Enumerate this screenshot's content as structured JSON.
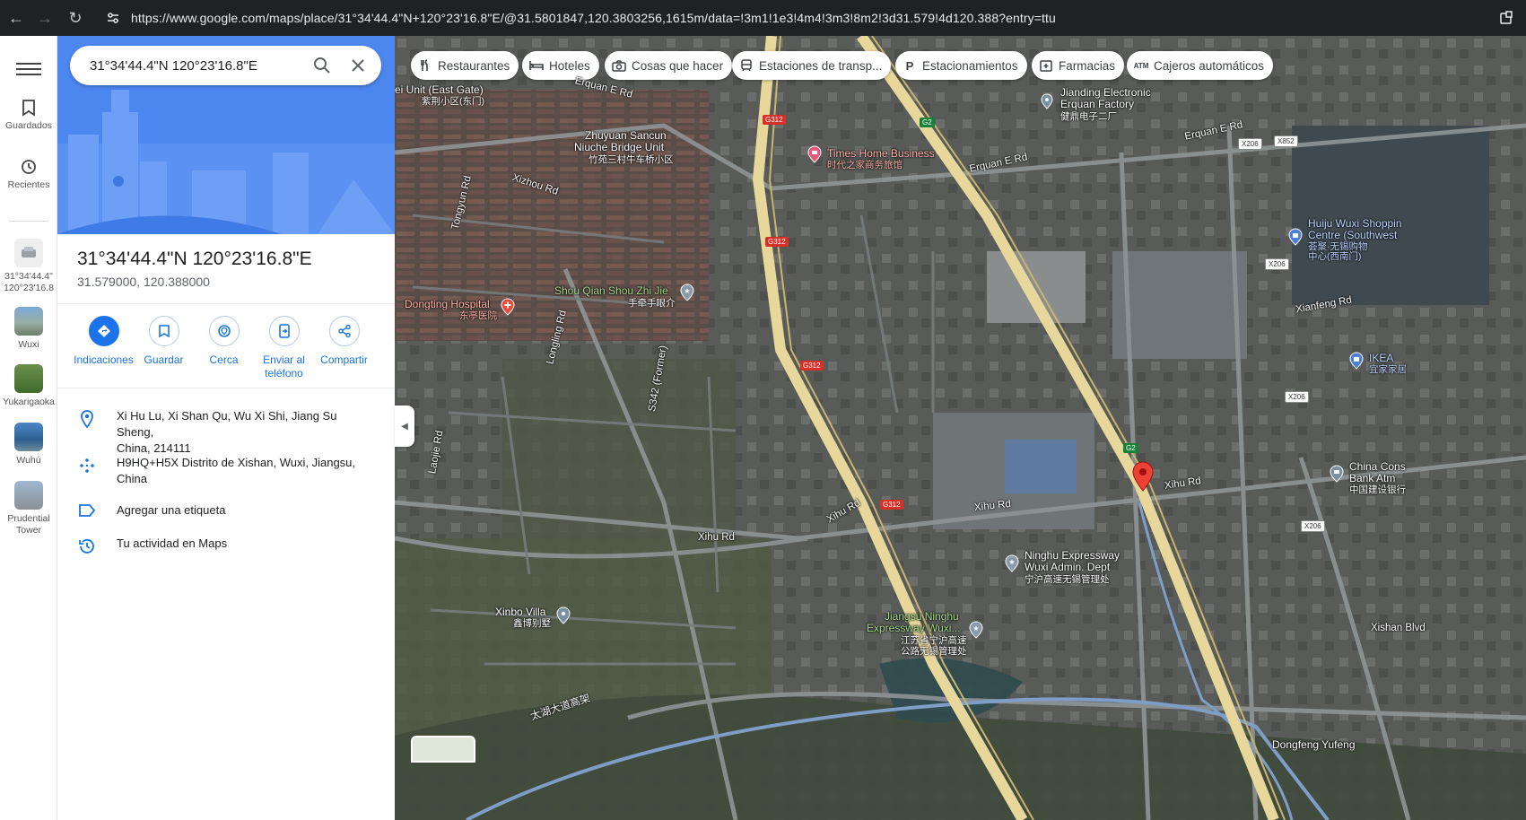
{
  "browser": {
    "url": "https://www.google.com/maps/place/31°34'44.4\"N+120°23'16.8\"E/@31.5801847,120.3803256,1615m/data=!3m1!1e3!4m4!3m3!8m2!3d31.579!4d120.388?entry=ttu"
  },
  "rail": {
    "saved": "Guardados",
    "recent": "Recientes",
    "history": [
      {
        "label": "31°34'44.4\"",
        "label2": "120°23'16.8"
      },
      {
        "label": "Wuxi"
      },
      {
        "label": "Yukarigaoka"
      },
      {
        "label": "Wuhú"
      },
      {
        "label": "Prudential",
        "label2": "Tower"
      }
    ]
  },
  "search": {
    "value": "31°34'44.4\"N 120°23'16.8\"E"
  },
  "place": {
    "title": "31°34'44.4\"N 120°23'16.8\"E",
    "coords": "31.579000, 120.388000"
  },
  "actions": {
    "directions": "Indicaciones",
    "save": "Guardar",
    "nearby": "Cerca",
    "send_line1": "Enviar al",
    "send_line2": "teléfono",
    "share": "Compartir"
  },
  "info": {
    "address_line1": "Xi Hu Lu, Xi Shan Qu, Wu Xi Shi, Jiang Su Sheng,",
    "address_line2": "China, 214111",
    "pluscode_line1": "H9HQ+H5X Distrito de Xishan, Wuxi, Jiangsu,",
    "pluscode_line2": "China",
    "label": "Agregar una etiqueta",
    "activity": "Tu actividad en Maps"
  },
  "chips": {
    "restaurants": "Restaurantes",
    "hotels": "Hoteles",
    "things": "Cosas que hacer",
    "transit": "Estaciones de transp...",
    "parking": "Estacionamientos",
    "pharmacy": "Farmacias",
    "atm": "Cajeros automáticos"
  },
  "map_labels": {
    "erquan_gate": "ei Unit (East Gate)",
    "erquan_gate_cn": "紫荆小区(东门)",
    "erquan_e_top": "Erquan E Rd",
    "jianding_1": "Jianding Electronic",
    "jianding_2": "Erquan Factory",
    "jianding_cn": "健鼎电子二厂",
    "zhuyuan_1": "Zhuyuan Sancun",
    "zhuyuan_2": "Niuche Bridge Unit",
    "zhuyuan_cn": "竹苑三村牛车桥小区",
    "times_1": "Times Home Business",
    "times_cn": "时代之家商务旅馆",
    "erquan_e_rd": "Erquan E Rd",
    "erquan_e_rd2": "Erquan E Rd",
    "xizhou": "Xizhou Rd",
    "tongyun": "Tongyun Rd",
    "huiju_1": "Huiju Wuxi Shoppin",
    "huiju_2": "Centre (Southwest",
    "huiju_cn1": "荟聚·无锡购物",
    "huiju_cn2": "中心(西南门)",
    "dongting": "Dongting Hospital",
    "dongting_cn": "东亭医院",
    "shouqian": "Shou Qian Shou Zhi Jie",
    "shouqian_cn": "手牵手眼介",
    "xianfeng": "Xianfeng Rd",
    "ikea": "IKEA",
    "ikea_cn": "宜家家居",
    "longling": "Longling Rd",
    "s342": "S342 (Former)",
    "laojie": "Laojie Rd",
    "xihu_1": "Xihu Rd",
    "xihu_2": "Xihu Rd",
    "xihu_3": "Xihu Rd",
    "xihu_4": "Xihu Rd",
    "ccb_1": "China Cons",
    "ccb_2": "Bank Atm",
    "ccb_cn": "中国建设银行",
    "ninghu_1": "Ninghu Expressway",
    "ninghu_2": "Wuxi Admin. Dept",
    "ninghu_cn": "宁沪高速无锡管理处",
    "xinbo": "Xinbo Villa",
    "xinbo_cn": "鑫博别墅",
    "jsninghu_1": "Jiangsu Ninghu",
    "jsninghu_2": "Expressway Wuxi...",
    "jsninghu_cn1": "江苏省宁沪高速",
    "jsninghu_cn2": "公路无锡管理处",
    "xishan_blvd": "Xishan Blvd",
    "taihu": "太湖大道高架",
    "dongfeng": "Dongfeng Yufeng"
  },
  "shields": {
    "g312": "G312",
    "g2": "G2",
    "x206": "X206",
    "x852": "X852"
  }
}
